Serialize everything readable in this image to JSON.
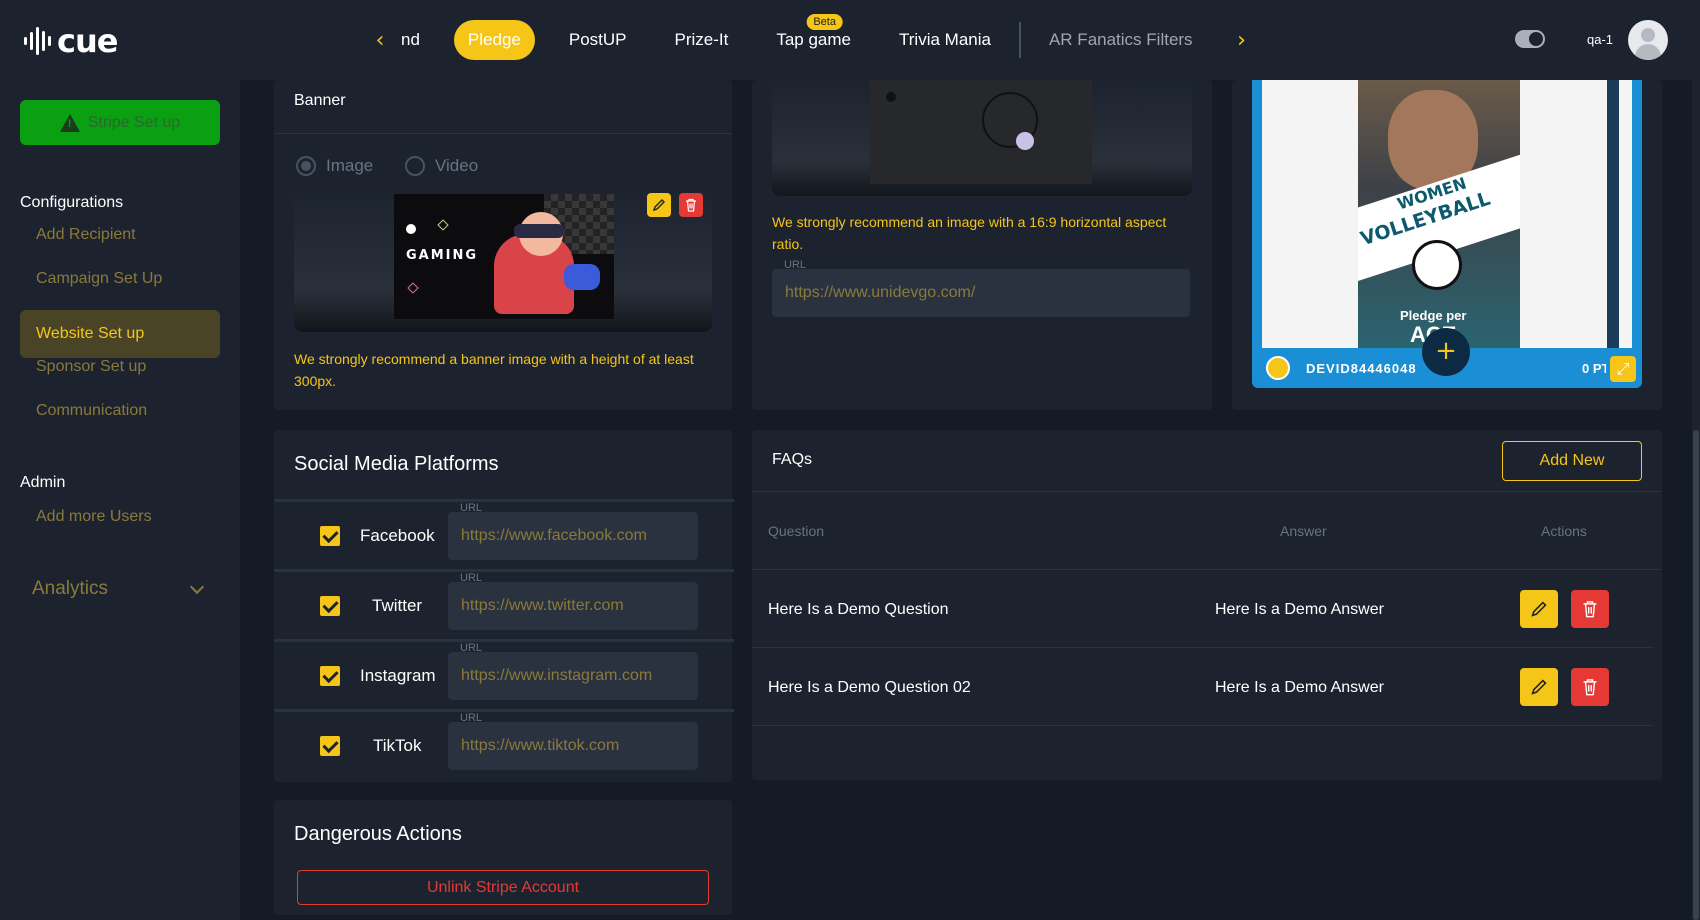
{
  "app": {
    "logo_text": "cue",
    "username": "qa-1"
  },
  "nav": {
    "items": [
      {
        "label": "nd"
      },
      {
        "label": "Pledge",
        "active": true
      },
      {
        "label": "PostUP"
      },
      {
        "label": "Prize-It"
      },
      {
        "label": "Tap game",
        "badge": "Beta"
      },
      {
        "label": "Trivia Mania"
      },
      {
        "label": "AR Fanatics Filters"
      }
    ]
  },
  "sidebar": {
    "stripe_button": "Stripe Set up",
    "configurations_heading": "Configurations",
    "config_items": [
      "Add Recipient",
      "Campaign Set Up",
      "Website Set up",
      "Sponsor Set up",
      "Communication"
    ],
    "admin_heading": "Admin",
    "admin_items": [
      "Add more Users"
    ],
    "analytics_label": "Analytics"
  },
  "banner": {
    "title": "Banner",
    "radio_image": "Image",
    "radio_video": "Video",
    "graphic_text": "GAMING",
    "note": "We strongly recommend a banner image with a height of at least 300px."
  },
  "website": {
    "note": "We strongly recommend an image with a 16:9 horizontal aspect ratio.",
    "url_label": "URL",
    "url_value": "https://www.unidevgo.com/"
  },
  "preview": {
    "poster_title_1": "WOMEN",
    "poster_title_2": "VOLLEYBALL",
    "poster_caption": "Pledge per",
    "poster_caption_2": "ACE",
    "bar_user": "DEVID8444604834",
    "bar_points": "0 PT"
  },
  "social": {
    "title": "Social Media Platforms",
    "url_label": "URL",
    "platforms": [
      {
        "name": "Facebook",
        "url": "https://www.facebook.com"
      },
      {
        "name": "Twitter",
        "url": "https://www.twitter.com"
      },
      {
        "name": "Instagram",
        "url": "https://www.instagram.com"
      },
      {
        "name": "TikTok",
        "url": "https://www.tiktok.com"
      }
    ]
  },
  "faqs": {
    "title": "FAQs",
    "add_button": "Add New",
    "columns": [
      "Question",
      "Answer",
      "Actions"
    ],
    "rows": [
      {
        "question": "Here Is a Demo Question",
        "answer": "Here Is a Demo Answer"
      },
      {
        "question": "Here Is a Demo Question 02",
        "answer": "Here Is a Demo Answer"
      }
    ]
  },
  "danger": {
    "title": "Dangerous Actions",
    "unlink_button": "Unlink Stripe Account"
  },
  "colors": {
    "accent": "#f5c518",
    "danger": "#e53935",
    "success": "#0aa012",
    "panel": "#1c232f",
    "background": "#151b24"
  }
}
